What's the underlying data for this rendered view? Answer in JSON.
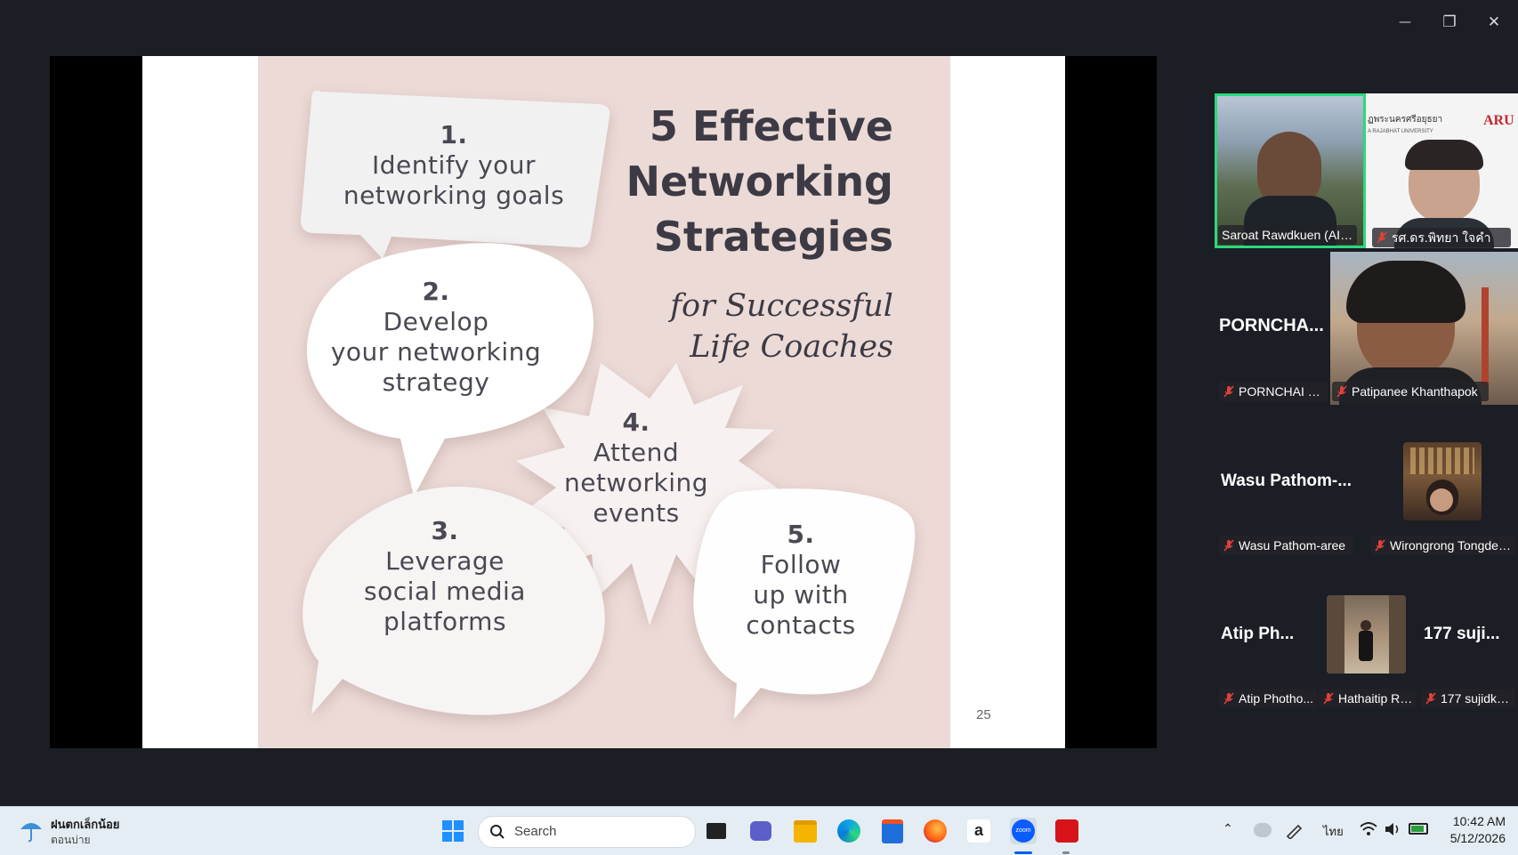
{
  "window": {
    "minimize_glyph": "—",
    "restore_glyph": "❐",
    "close_glyph": "✕"
  },
  "slide": {
    "title_lines": [
      "5 Effective",
      "Networking",
      "Strategies"
    ],
    "subtitle_lines": [
      "for Successful",
      "Life Coaches"
    ],
    "bubbles": [
      {
        "number": "1.",
        "lines": [
          "Identify your",
          "networking goals"
        ]
      },
      {
        "number": "2.",
        "lines": [
          "Develop",
          "your networking",
          "strategy"
        ]
      },
      {
        "number": "3.",
        "lines": [
          "Leverage",
          "social media",
          "platforms"
        ]
      },
      {
        "number": "4.",
        "lines": [
          "Attend",
          "networking",
          "events"
        ]
      },
      {
        "number": "5.",
        "lines": [
          "Follow",
          "up with",
          "contacts"
        ]
      }
    ],
    "page_number": "25"
  },
  "participants": {
    "tile1_label": "Saroat Rawdkuen (AI-MF...",
    "tile2_label": "รศ.ดร.พิทยา ใจคำ",
    "tile2_banner": "ฏพระนครศรีอยุธยา",
    "tile2_banner_sub": "A RAJABHAT UNIVERSITY",
    "tile2_logo": "ARU",
    "tile3_big": "PORNCHA...",
    "tile3_label": "PORNCHAI RA...",
    "tile4_label": "Patipanee Khanthapok",
    "tile5_big": "Wasu  Pathom-...",
    "tile5_label": "Wasu Pathom-aree",
    "tile6_label": "Wirongrong Tongdee...",
    "tile7_big": "Atip  Ph...",
    "tile7_label": "Atip Photho...",
    "tile8_label": "Hathaitip Ro...",
    "tile9_big": "177  suji...",
    "tile9_label": "177 sujidka..."
  },
  "taskbar": {
    "weather_line1": "ฝนตกเล็กน้อย",
    "weather_line2": "ตอนบ่าย",
    "search_placeholder": "Search",
    "lang": "ไทย",
    "time": "10:42 AM",
    "date": "5/12/2026",
    "amazon_glyph": "a",
    "zoom_glyph": "zoom"
  },
  "colors": {
    "active_speaker": "#2bd97c",
    "poster_bg": "#ecdad6",
    "mute_red": "#e0413a",
    "taskbar_bg": "#e4edf3"
  }
}
